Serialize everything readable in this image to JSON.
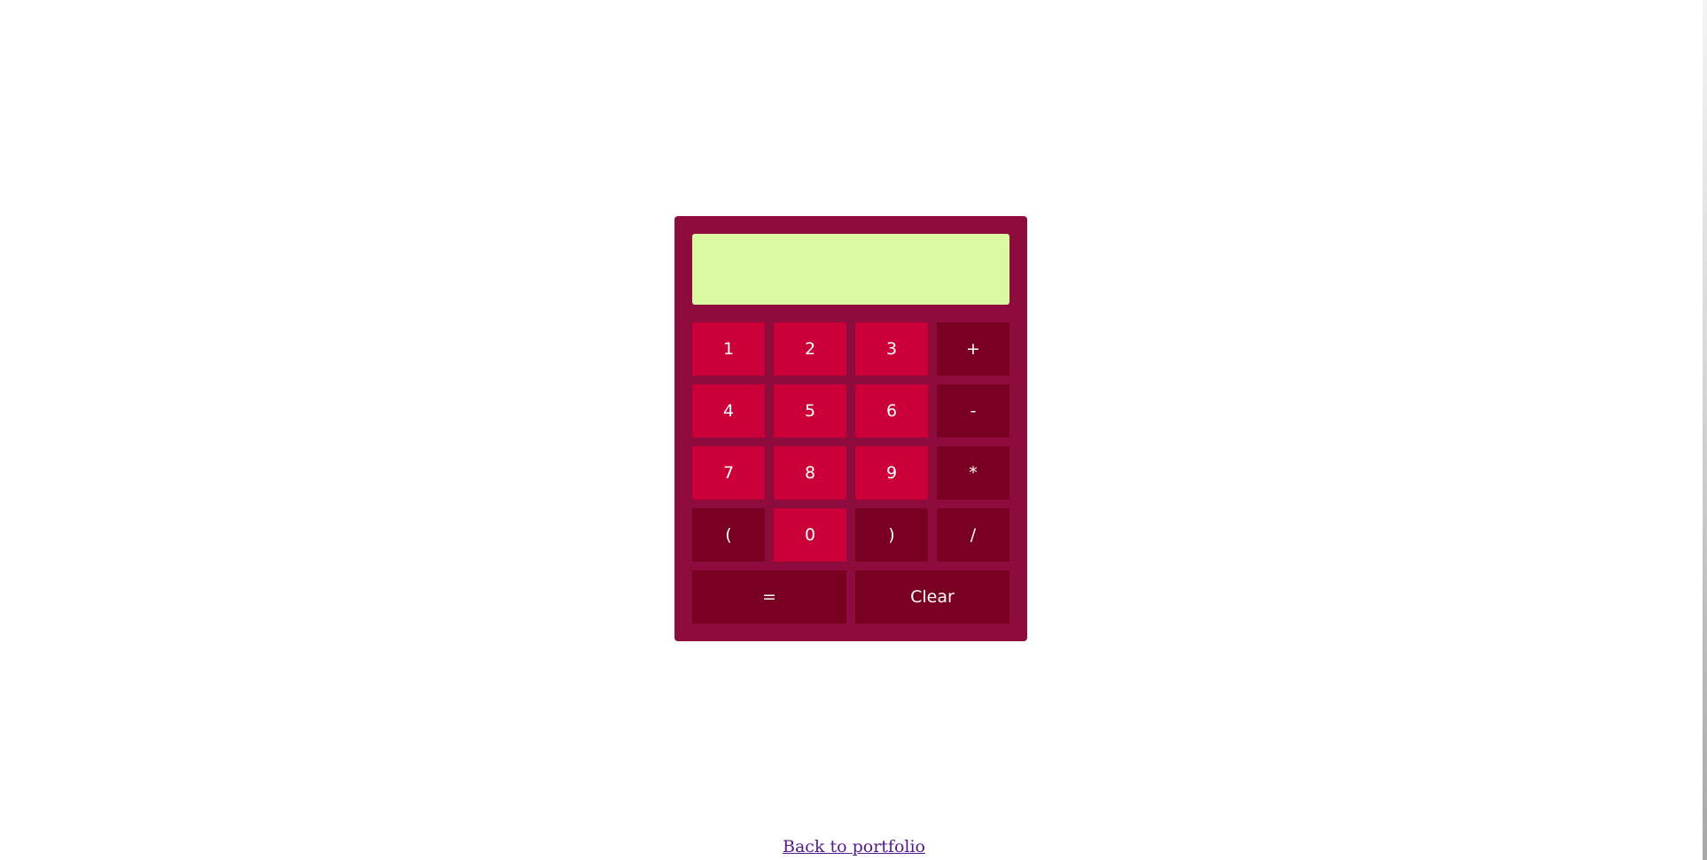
{
  "calculator": {
    "display": {
      "value": "",
      "placeholder": ""
    },
    "keys": [
      {
        "label": "1",
        "kind": "num"
      },
      {
        "label": "2",
        "kind": "num"
      },
      {
        "label": "3",
        "kind": "num"
      },
      {
        "label": "+",
        "kind": "op"
      },
      {
        "label": "4",
        "kind": "num"
      },
      {
        "label": "5",
        "kind": "num"
      },
      {
        "label": "6",
        "kind": "num"
      },
      {
        "label": "-",
        "kind": "op"
      },
      {
        "label": "7",
        "kind": "num"
      },
      {
        "label": "8",
        "kind": "num"
      },
      {
        "label": "9",
        "kind": "num"
      },
      {
        "label": "*",
        "kind": "op"
      },
      {
        "label": "(",
        "kind": "op"
      },
      {
        "label": "0",
        "kind": "num"
      },
      {
        "label": ")",
        "kind": "op"
      },
      {
        "label": "/",
        "kind": "op"
      },
      {
        "label": "=",
        "kind": "op"
      },
      {
        "label": "Clear",
        "kind": "op"
      }
    ]
  },
  "footer": {
    "back_link_label": "Back to portfolio"
  },
  "colors": {
    "calculator_body": "#8e0b3d",
    "display_bg": "#dbf9a0",
    "number_key": "#cc0039",
    "operator_key": "#7a0022",
    "link": "#551a8b"
  }
}
